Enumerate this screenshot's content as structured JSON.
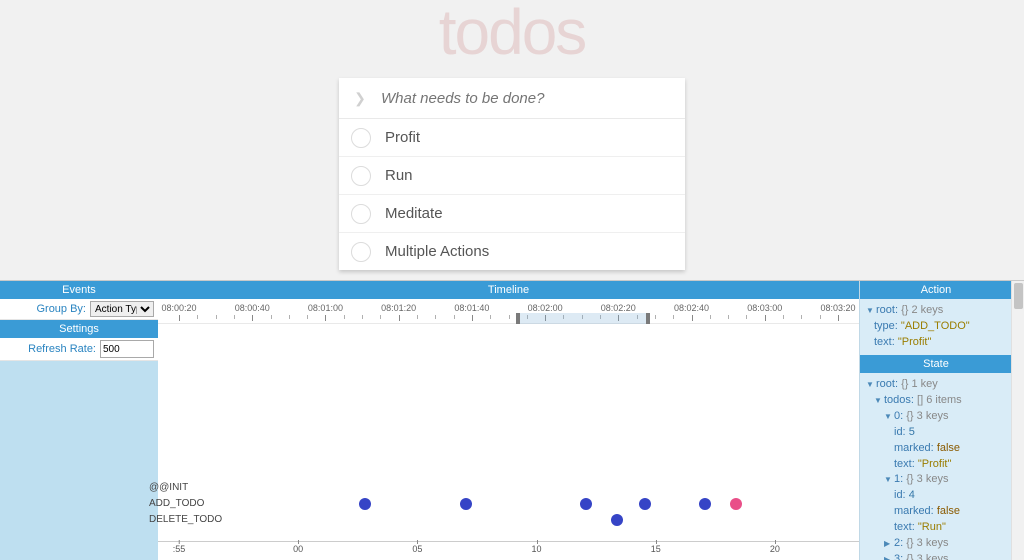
{
  "app": {
    "title": "todos",
    "input_placeholder": "What needs to be done?",
    "items": [
      "Profit",
      "Run",
      "Meditate",
      "Multiple Actions"
    ]
  },
  "left": {
    "events_hdr": "Events",
    "groupby_label": "Group By:",
    "groupby_value": "Action Type",
    "settings_hdr": "Settings",
    "refresh_label": "Refresh Rate:",
    "refresh_value": "500"
  },
  "timeline": {
    "hdr": "Timeline",
    "ticks": [
      "08:00:20",
      "08:00:40",
      "08:01:00",
      "08:01:20",
      "08:01:40",
      "08:02:00",
      "08:02:20",
      "08:02:40",
      "08:03:00",
      "08:03:20"
    ],
    "brush_start_pct": 51.0,
    "brush_end_pct": 69.0,
    "row_labels": [
      "@@INIT",
      "ADD_TODO",
      "DELETE_TODO"
    ],
    "dots": [
      {
        "row": 1,
        "x_pct": 29.5,
        "color": "blue"
      },
      {
        "row": 1,
        "x_pct": 44.0,
        "color": "blue"
      },
      {
        "row": 1,
        "x_pct": 61.0,
        "color": "blue"
      },
      {
        "row": 1,
        "x_pct": 69.5,
        "color": "blue"
      },
      {
        "row": 1,
        "x_pct": 78.0,
        "color": "blue"
      },
      {
        "row": 1,
        "x_pct": 82.5,
        "color": "pink"
      },
      {
        "row": 2,
        "x_pct": 65.5,
        "color": "blue"
      }
    ],
    "xaxis": [
      {
        "pos_pct": 3,
        "label": ":55"
      },
      {
        "pos_pct": 20,
        "label": "00"
      },
      {
        "pos_pct": 37,
        "label": "05"
      },
      {
        "pos_pct": 54,
        "label": "10"
      },
      {
        "pos_pct": 71,
        "label": "15"
      },
      {
        "pos_pct": 88,
        "label": "20"
      }
    ]
  },
  "inspector": {
    "action_hdr": "Action",
    "state_hdr": "State",
    "action": {
      "root_label": "root:",
      "root_meta": "{}  2 keys",
      "type_k": "type:",
      "type_v": "\"ADD_TODO\"",
      "text_k": "text:",
      "text_v": "\"Profit\""
    },
    "state": {
      "root_label": "root:",
      "root_meta": "{}  1 key",
      "todos_k": "todos:",
      "todos_meta": "[]  6 items",
      "i0_k": "0:",
      "i0_meta": "{}  3 keys",
      "id_k": "id:",
      "id0_v": "5",
      "marked_k": "marked:",
      "marked_v": "false",
      "text_k": "text:",
      "text0_v": "\"Profit\"",
      "i1_k": "1:",
      "i1_meta": "{}  3 keys",
      "id1_v": "4",
      "text1_v": "\"Run\"",
      "i2_k": "2:",
      "i2_meta": "{}  3 keys",
      "i3_k": "3:",
      "i3_meta": "{}  3 keys"
    }
  }
}
